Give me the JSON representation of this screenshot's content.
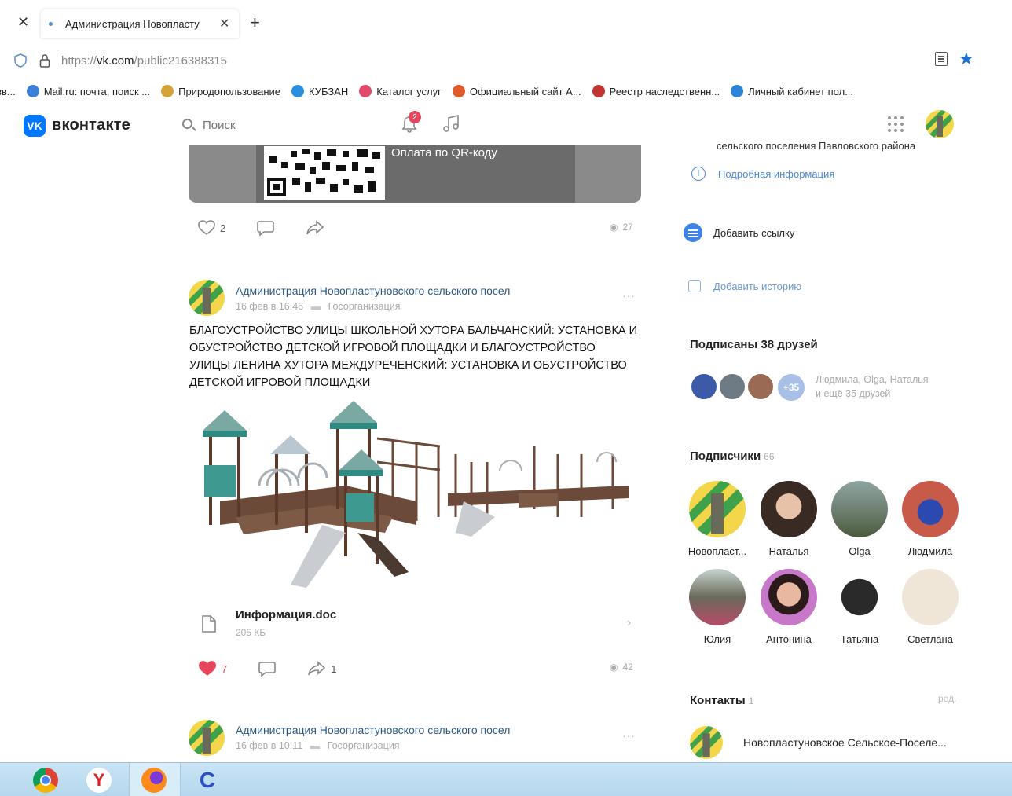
{
  "browser": {
    "tab_title": "Администрация Новопласту",
    "url_prefix": "https://",
    "url_host": "vk.com",
    "url_path": "/public216388315"
  },
  "bookmarks": [
    {
      "label": "зв...",
      "color": "#ffffff"
    },
    {
      "label": "Mail.ru: почта, поиск ...",
      "color": "#3b7fd6"
    },
    {
      "label": "Природопользование",
      "color": "#d6a33b"
    },
    {
      "label": "КУБЗАН",
      "color": "#2b8fe0"
    },
    {
      "label": "Каталог услуг",
      "color": "#e24a6c"
    },
    {
      "label": "Официальный сайт А...",
      "color": "#e05a2a"
    },
    {
      "label": "Реестр наследственн...",
      "color": "#c2342f"
    },
    {
      "label": "Личный кабинет пол...",
      "color": "#2b84d6"
    }
  ],
  "vk": {
    "logo_text": "VK",
    "brand": "вконтакте",
    "search_placeholder": "Поиск",
    "notifications_count": "2"
  },
  "feed": {
    "qr_caption": "Оплата по QR-коду",
    "post1": {
      "likes": "2",
      "views": "27"
    },
    "post2": {
      "author": "Администрация Новопластуновского сельского посел",
      "date": "16 фев в 16:46",
      "category": "Госорганизация",
      "more": "···",
      "text": "БЛАГОУСТРОЙСТВО УЛИЦЫ ШКОЛЬНОЙ ХУТОРА БАЛЬЧАНСКИЙ: УСТАНОВКА И ОБУСТРОЙСТВО ДЕТСКОЙ ИГРОВОЙ ПЛОЩАДКИ И БЛАГОУСТРОЙСТВО УЛИЦЫ ЛЕНИНА ХУТОРА МЕЖДУРЕЧЕНСКИЙ: УСТАНОВКА И ОБУСТРОЙСТВО ДЕТСКОЙ ИГРОВОЙ ПЛОЩАДКИ",
      "attachment_name": "Информация.doc",
      "attachment_size": "205 КБ",
      "likes": "7",
      "shares": "1",
      "views": "42"
    },
    "post3": {
      "author": "Администрация Новопластуновского сельского посел",
      "date": "16 фев в 10:11",
      "category": "Госорганизация",
      "more": "···"
    }
  },
  "sidebar": {
    "cut_text": "сельского поселения Павловского района",
    "details_link": "Подробная информация",
    "add_link": "Добавить ссылку",
    "add_story": "Добавить историю",
    "friends_title": "Подписаны 38 друзей",
    "friends_more": "+35",
    "friends_names_line1": "Людмила, Olga, Наталья",
    "friends_names_line2": "и ещё 35 друзей",
    "subscribers_title": "Подписчики",
    "subscribers_count": "66",
    "subscribers": [
      {
        "name": "Новопласт..."
      },
      {
        "name": "Наталья"
      },
      {
        "name": "Olga"
      },
      {
        "name": "Людмила"
      },
      {
        "name": "Юлия"
      },
      {
        "name": "Антонина"
      },
      {
        "name": "Татьяна"
      },
      {
        "name": "Светлана"
      }
    ],
    "contacts_title": "Контакты",
    "contacts_count": "1",
    "edit_label": "ред.",
    "contact_name": "Новопластуновское Сельское-Поселе..."
  },
  "colors": {
    "vk_blue": "#0077ff",
    "link": "#2a5885",
    "like_red": "#e6455b"
  }
}
